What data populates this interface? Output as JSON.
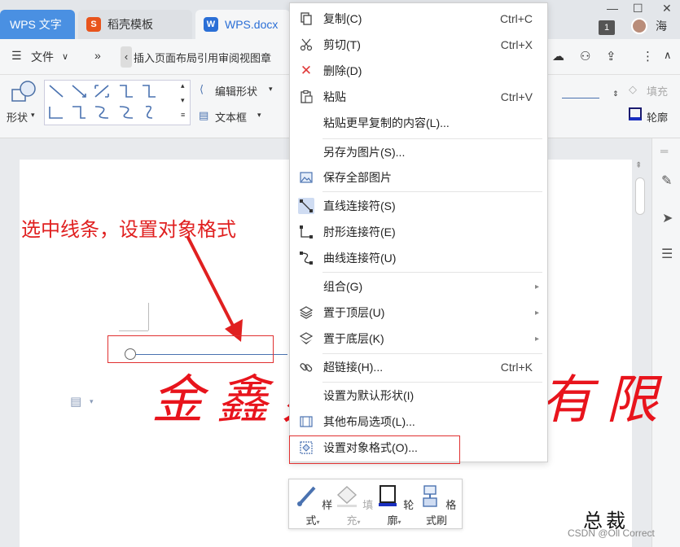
{
  "titlebar": {
    "tabs": [
      {
        "label": "WPS 文字"
      },
      {
        "label": "稻壳模板"
      },
      {
        "label": "WPS.docx"
      }
    ],
    "badge": "1",
    "user_initial": "海"
  },
  "menu": {
    "file_label": "文件",
    "ribbon_tabs": "插入页面布局引用审阅视图章"
  },
  "ribbon": {
    "shape_label": "形状",
    "edit_shape_label": "编辑形状",
    "textbox_label": "文本框",
    "fill_label": "填充",
    "outline_label": "轮廓"
  },
  "document": {
    "annotation": "选中线条，设置对象格式",
    "calligraphy_left": "金鑫办",
    "calligraphy_right": "有限",
    "signature": "总裁",
    "watermark": "CSDN @Oll Correct"
  },
  "context_menu": {
    "items": [
      {
        "label": "复制(C)",
        "shortcut": "Ctrl+C",
        "icon": "copy-icon"
      },
      {
        "label": "剪切(T)",
        "shortcut": "Ctrl+X",
        "icon": "cut-icon"
      },
      {
        "label": "删除(D)",
        "shortcut": "",
        "icon": "delete-icon"
      },
      {
        "label": "粘贴",
        "shortcut": "Ctrl+V",
        "icon": "paste-icon"
      },
      {
        "label": "粘贴更早复制的内容(L)...",
        "shortcut": "",
        "icon": ""
      },
      {
        "label": "另存为图片(S)...",
        "shortcut": "",
        "icon": ""
      },
      {
        "label": "保存全部图片",
        "shortcut": "",
        "icon": "image-icon"
      },
      {
        "label": "直线连接符(S)",
        "shortcut": "",
        "icon": "straight-connector-icon"
      },
      {
        "label": "肘形连接符(E)",
        "shortcut": "",
        "icon": "elbow-connector-icon"
      },
      {
        "label": "曲线连接符(U)",
        "shortcut": "",
        "icon": "curve-connector-icon"
      },
      {
        "label": "组合(G)",
        "shortcut": "",
        "icon": ""
      },
      {
        "label": "置于顶层(U)",
        "shortcut": "",
        "icon": "bring-front-icon"
      },
      {
        "label": "置于底层(K)",
        "shortcut": "",
        "icon": "send-back-icon"
      },
      {
        "label": "超链接(H)...",
        "shortcut": "Ctrl+K",
        "icon": "link-icon"
      },
      {
        "label": "设置为默认形状(I)",
        "shortcut": "",
        "icon": ""
      },
      {
        "label": "其他布局选项(L)...",
        "shortcut": "",
        "icon": "layout-icon"
      },
      {
        "label": "设置对象格式(O)...",
        "shortcut": "",
        "icon": "format-object-icon"
      }
    ]
  },
  "mini_toolbar": {
    "style_label": "样式",
    "fill_label": "填充",
    "outline_label": "轮廓",
    "painter_label": "格式刷"
  },
  "colors": {
    "accent": "#4a90e2",
    "annotation_red": "#e02020",
    "calligraphy_red": "#e8141c"
  }
}
